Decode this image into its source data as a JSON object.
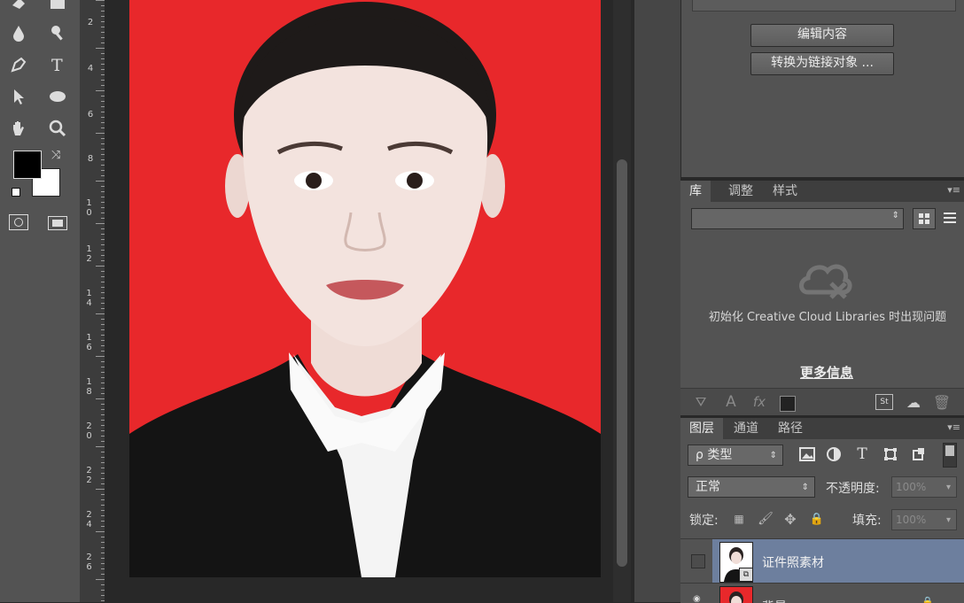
{
  "properties": {
    "edit_contents": "编辑内容",
    "convert_linked": "转换为链接对象 ..."
  },
  "libraries_tabs": [
    {
      "label": "库",
      "active": true
    },
    {
      "label": "调整",
      "active": false
    },
    {
      "label": "样式",
      "active": false
    }
  ],
  "libraries": {
    "message": "初始化 Creative Cloud Libraries 时出现问题",
    "more_info": "更多信息"
  },
  "layers_tabs": [
    {
      "label": "图层",
      "active": true
    },
    {
      "label": "通道",
      "active": false
    },
    {
      "label": "路径",
      "active": false
    }
  ],
  "layers": {
    "filter_kind": "ρ 类型",
    "blend_mode": "正常",
    "opacity_label": "不透明度:",
    "opacity_value": "100%",
    "lock_label": "锁定:",
    "fill_label": "填充:",
    "fill_value": "100%",
    "items": [
      {
        "name": "证件照素材",
        "selected": true
      },
      {
        "name": "背景",
        "selected": false
      }
    ]
  },
  "ruler": {
    "labels": [
      "2",
      "4",
      "6",
      "8",
      "10",
      "12",
      "14",
      "16",
      "18",
      "20",
      "22",
      "24",
      "26"
    ]
  },
  "colors": {
    "panel": "#535353",
    "canvas_bg": "#282828",
    "photo_bg": "#e8282b",
    "selected_layer": "#6d7f9e"
  }
}
